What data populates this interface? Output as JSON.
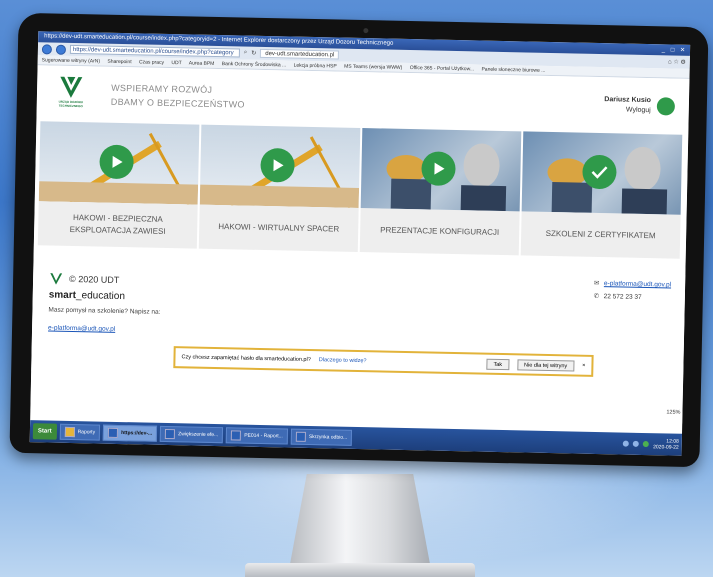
{
  "browser": {
    "title": "https://dev-udt.smarteducation.pl/course/index.php?categoryid=2 - Internet Explorer dostarczony przez Urząd Dozoru Technicznego",
    "url": "https://dev-udt.smarteducation.pl/course/index.php?category",
    "tab_label": "dev-udt.smarteducation.pl",
    "favorites": [
      "Sugerowane witryny (ArN)",
      "Sharepoint",
      "Czas pracy",
      "UDT",
      "Aurea BPM",
      "Bank Ochrony Środowiska ...",
      "Lekcja próbna HSP",
      "MS Teams (wersja WWW)",
      "Office 365 - Portal Użytkow...",
      "Panele słoneczne biurowe ..."
    ],
    "zoom": "125%"
  },
  "header": {
    "logo_text": "URZĄD DOZORU TECHNICZNEGO",
    "slogan_line1": "WSPIERAMY ROZWÓJ",
    "slogan_line2": "DBAMY O BEZPIECZEŃSTWO",
    "user_name": "Dariusz Kusio",
    "logout": "Wyloguj"
  },
  "cards": [
    {
      "label": "HAKOWI - BEZPIECZNA EKSPLOATACJA ZAWIESI",
      "icon": "play-icon"
    },
    {
      "label": "HAKOWI - WIRTUALNY SPACER",
      "icon": "play-icon"
    },
    {
      "label": "PREZENTACJE KONFIGURACJI",
      "icon": "play-icon"
    },
    {
      "label": "SZKOLENI Z CERTYFIKATEM",
      "icon": "check-icon"
    }
  ],
  "footer": {
    "copyright": "© 2020 UDT",
    "brand_bold": "smart",
    "brand_rest": "_education",
    "idea": "Masz pomysł na szkolenie? Napisz na:",
    "email_left": "e-platforma@udt.gov.pl",
    "email_right": "e-platforma@udt.gov.pl",
    "phone": "22 572 23 37"
  },
  "notification": {
    "text": "Czy chcesz zapamiętać hasło dla smarteducation.pl?",
    "link": "Dlaczego to widzę?",
    "yes": "Tak",
    "never": "Nie dla tej witryny",
    "close": "×"
  },
  "taskbar": {
    "start": "Start",
    "items": [
      "Raporty",
      "https://dev-...",
      "Zwiększenie efe...",
      "PE014 - Raport...",
      "Skrzynka odbio..."
    ],
    "time": "12:08",
    "date": "2020-09-22"
  },
  "colors": {
    "accent_green": "#2f9a4a",
    "link_blue": "#1a55b8",
    "background_blue": "#3c77c9"
  }
}
